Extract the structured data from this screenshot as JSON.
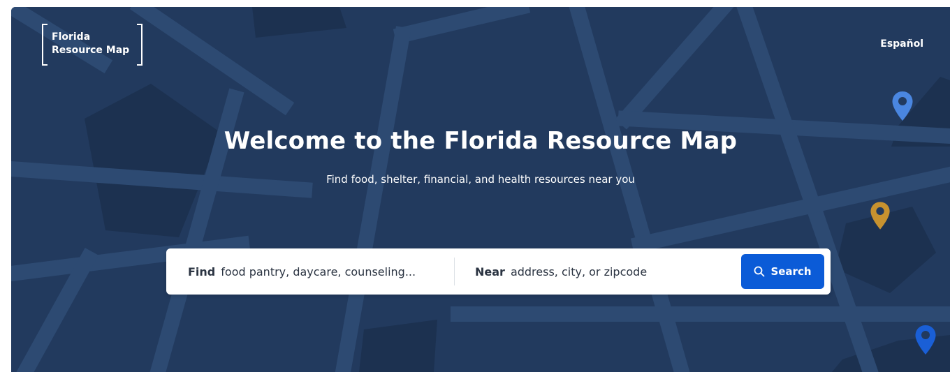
{
  "header": {
    "logo_line1": "Florida",
    "logo_line2": "Resource Map",
    "language_link": "Español"
  },
  "hero": {
    "title": "Welcome to the Florida Resource Map",
    "subtitle": "Find food, shelter, financial, and health resources near you"
  },
  "search": {
    "find_label": "Find",
    "find_placeholder": "food pantry, daycare, counseling...",
    "near_label": "Near",
    "near_placeholder": "address, city, or zipcode",
    "button_label": "Search"
  },
  "colors": {
    "background": "#223a5e",
    "accent": "#0b5bd7",
    "pin_light_blue": "#4a86e0",
    "pin_gold": "#c7922f",
    "pin_blue": "#1a5fd6"
  },
  "icons": {
    "search_button": "search-icon",
    "map_pins": "map-pin-icon"
  }
}
